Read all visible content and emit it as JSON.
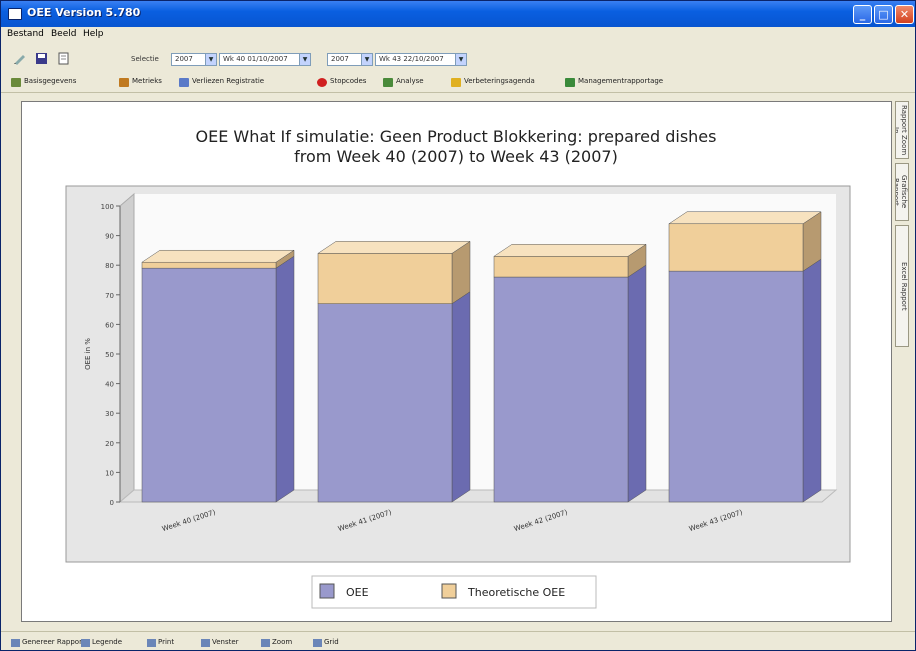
{
  "window": {
    "title": "OEE Version 5.780"
  },
  "menu": [
    "Bestand",
    "Beeld",
    "Help"
  ],
  "toolbar": {
    "period_label": "Selectie",
    "from_year": "2007",
    "from_week": "Wk 40 01/10/2007",
    "to_year": "2007",
    "to_week": "Wk 43 22/10/2007"
  },
  "nav": [
    {
      "label": "Basisgegevens",
      "icon": "database-icon",
      "color": "#6a8a3a"
    },
    {
      "label": "Metrieks",
      "icon": "metrics-icon",
      "color": "#c07a20"
    },
    {
      "label": "Verliezen Registratie",
      "icon": "registration-icon",
      "color": "#5a7ac8"
    },
    {
      "label": "Stopcodes",
      "icon": "stop-icon",
      "color": "#d02020"
    },
    {
      "label": "Analyse",
      "icon": "analysis-icon",
      "color": "#4a8a3a"
    },
    {
      "label": "Verbeteringsagenda",
      "icon": "agenda-icon",
      "color": "#e0b020"
    },
    {
      "label": "Managementrapportage",
      "icon": "report-icon",
      "color": "#3a8a3a"
    }
  ],
  "side_tabs": [
    "Rapport Zoom In",
    "Grafische Rapport",
    "Excel Rapport"
  ],
  "bottom": [
    {
      "label": "Genereer Rapport",
      "icon": "generate-icon"
    },
    {
      "label": "Legende",
      "icon": "legend-icon"
    },
    {
      "label": "Print",
      "icon": "print-icon"
    },
    {
      "label": "Venster",
      "icon": "window-icon"
    },
    {
      "label": "Zoom",
      "icon": "zoom-icon"
    },
    {
      "label": "Grid",
      "icon": "grid-icon"
    }
  ],
  "chart_data": {
    "type": "bar",
    "stacked": true,
    "title_line1": "OEE What If simulatie: Geen Product Blokkering: prepared dishes",
    "title_line2": "from Week 40 (2007) to Week 43 (2007)",
    "ylabel": "OEE in %",
    "ylim": [
      0,
      100
    ],
    "yticks": [
      0,
      10,
      20,
      30,
      40,
      50,
      60,
      70,
      80,
      90,
      100
    ],
    "categories": [
      "Week 40 (2007)",
      "Week 41 (2007)",
      "Week 42 (2007)",
      "Week 43 (2007)"
    ],
    "series": [
      {
        "name": "OEE",
        "values": [
          79,
          67,
          76,
          78
        ],
        "color": "#9999cc"
      },
      {
        "name": "Theoretische OEE",
        "values": [
          2,
          17,
          7,
          16
        ],
        "color": "#f0cf9a"
      }
    ],
    "legend_position": "bottom"
  }
}
